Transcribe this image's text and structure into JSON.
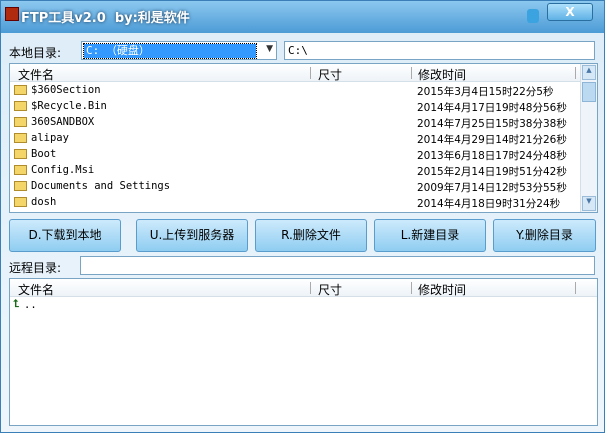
{
  "window": {
    "title": "FTP工具v2.0  by:利是软件",
    "close_label": "X"
  },
  "local": {
    "label": "本地目录:",
    "drive": "C: （硬盘）",
    "path": "C:\\"
  },
  "columns": {
    "name": "文件名",
    "size": "尺寸",
    "modified": "修改时间"
  },
  "local_files": [
    {
      "name": "$360Section",
      "size": "",
      "modified": "2015年3月4日15时22分5秒"
    },
    {
      "name": "$Recycle.Bin",
      "size": "",
      "modified": "2014年4月17日19时48分56秒"
    },
    {
      "name": "360SANDBOX",
      "size": "",
      "modified": "2014年7月25日15时38分38秒"
    },
    {
      "name": "alipay",
      "size": "",
      "modified": "2014年4月29日14时21分26秒"
    },
    {
      "name": "Boot",
      "size": "",
      "modified": "2013年6月18日17时24分48秒"
    },
    {
      "name": "Config.Msi",
      "size": "",
      "modified": "2015年2月14日19时51分42秒"
    },
    {
      "name": "Documents and Settings",
      "size": "",
      "modified": "2009年7月14日12时53分55秒"
    },
    {
      "name": "dosh",
      "size": "",
      "modified": "2014年4月18日9时31分24秒"
    }
  ],
  "buttons": [
    "D.下载到本地",
    "U.上传到服务器",
    "R.删除文件",
    "L.新建目录",
    "Y.删除目录"
  ],
  "remote": {
    "label": "远程目录:",
    "path": "",
    "files": [
      {
        "name": "..",
        "size": "",
        "modified": ""
      }
    ]
  }
}
